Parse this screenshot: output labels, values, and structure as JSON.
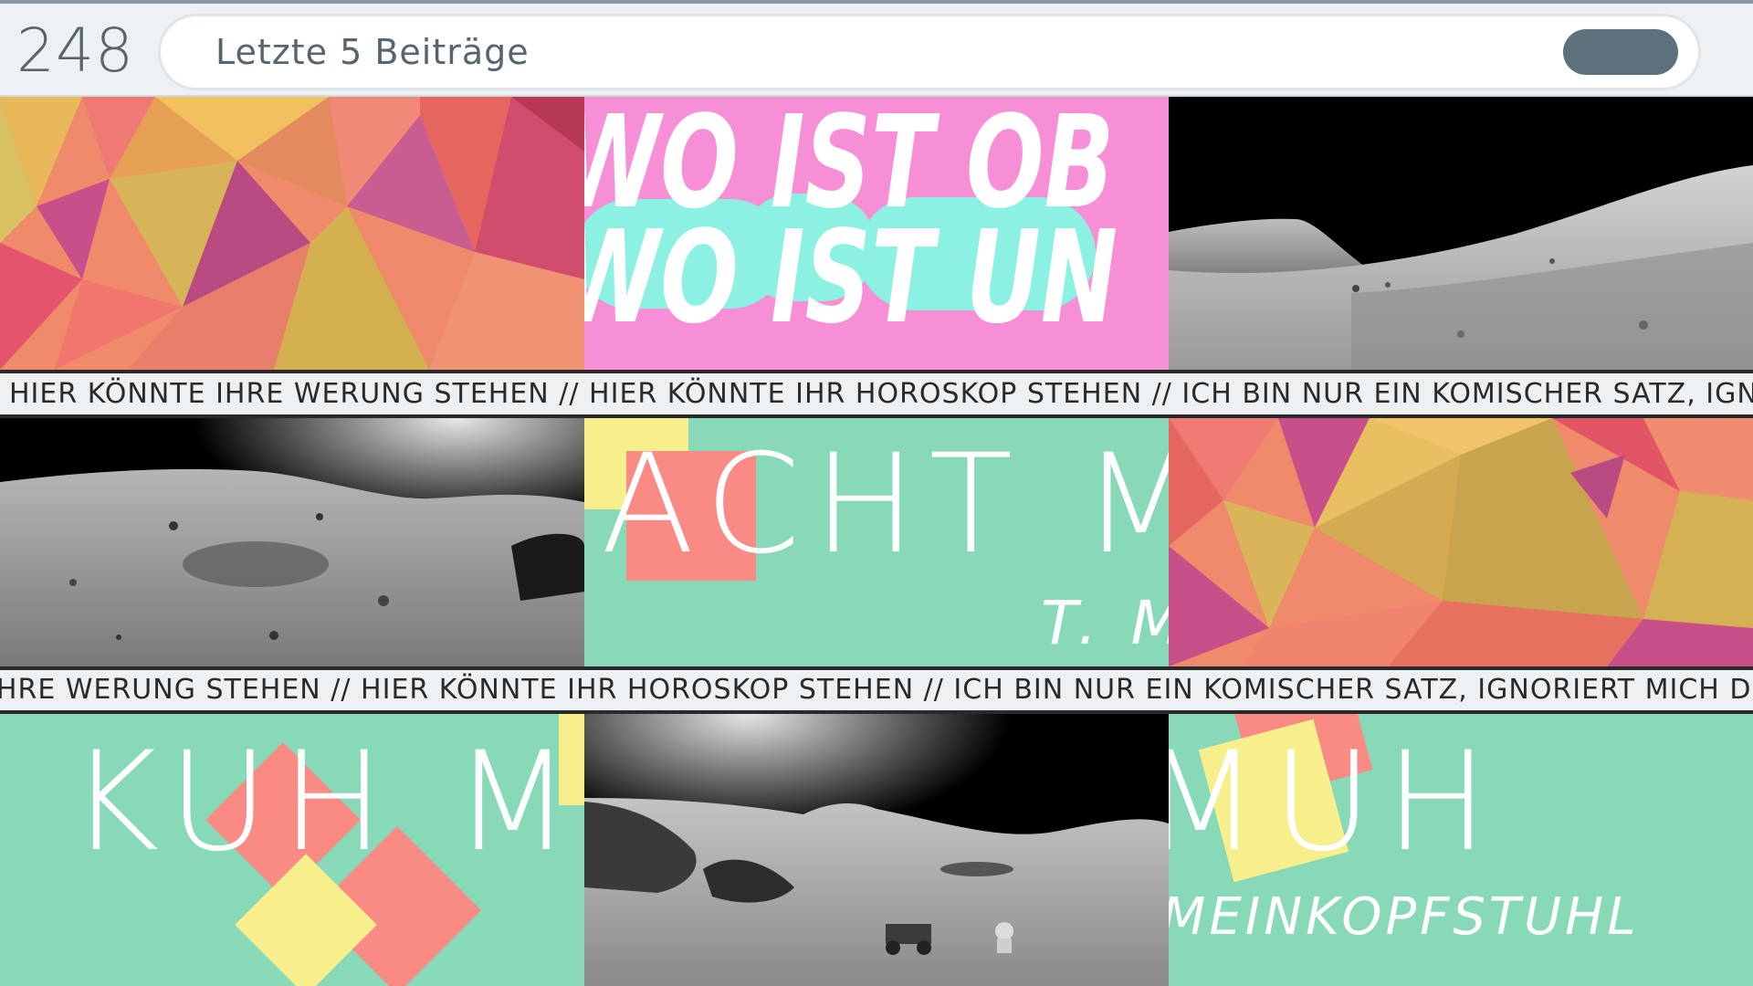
{
  "header": {
    "counter": "248",
    "search_text": "Letzte 5 Beiträge"
  },
  "tickers": [
    "HIER KÖNNTE IHRE WERUNG STEHEN // HIER KÖNNTE IHR HOROSKOP STEHEN // ICH BIN NUR EIN KOMISCHER SATZ, IGNORIERT MICH DOCH",
    "HIER KÖNNTE IHRE WERUNG STEHEN // HIER KÖNNTE IHR HOROSKOP STEHEN // ICH BIN NUR EIN KOMISCHER SATZ, IGNORIERT MICH DOCH"
  ],
  "tiles": {
    "wo_ist_line1": "WO IST OB",
    "wo_ist_line2": "WO IST UN",
    "acht_title": "ACHT M",
    "acht_sub": "T. M",
    "kuh_title": "KUH M",
    "muh_title": "MUH",
    "muh_sub": "MEINKOPFSTUHL"
  },
  "colors": {
    "mint": "#88d9b8",
    "pink": "#f78fd6",
    "aqua": "#8cf1e2",
    "coral": "#f98b84",
    "yellow": "#f7ee8c",
    "header_bg": "#edf1f3",
    "search_button": "#5c717c"
  }
}
